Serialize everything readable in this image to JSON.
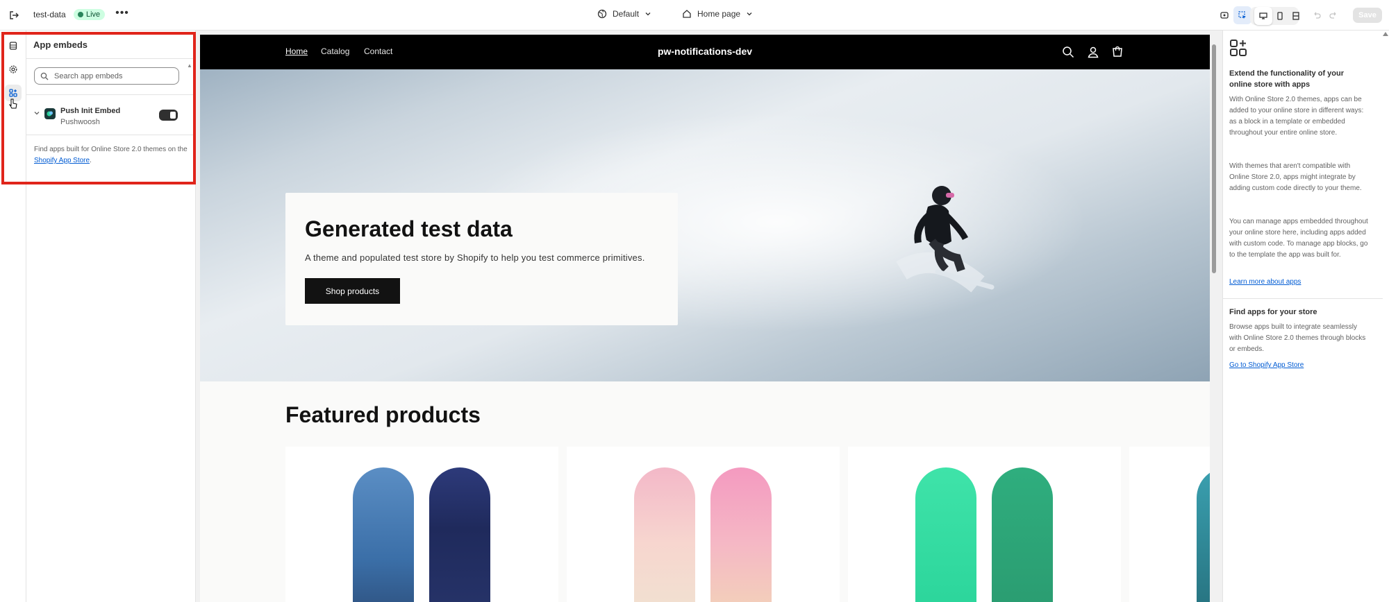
{
  "topbar": {
    "store_name": "test-data",
    "status_badge": "Live",
    "more_label": "•••",
    "theme": "Default",
    "page": "Home page",
    "save_label": "Save"
  },
  "sidebar": {
    "title": "App embeds",
    "search_placeholder": "Search app embeds",
    "embed": {
      "name": "Push Init Embed",
      "provider": "Pushwoosh",
      "enabled": true
    },
    "footer_text": "Find apps built for Online Store 2.0 themes on the ",
    "footer_link": "Shopify App Store",
    "footer_end": "."
  },
  "store": {
    "nav": [
      "Home",
      "Catalog",
      "Contact"
    ],
    "brand": "pw-notifications-dev",
    "hero_title": "Generated test data",
    "hero_subtitle": "A theme and populated test store by Shopify to help you test commerce primitives.",
    "hero_button": "Shop products",
    "featured_title": "Featured products"
  },
  "right_panel": {
    "heading1": "Extend the functionality of your online store with apps",
    "para1": "With Online Store 2.0 themes, apps can be added to your online store in different ways: as a block in a template or embedded throughout your entire online store.",
    "para2": "With themes that aren't compatible with Online Store 2.0, apps might integrate by adding custom code directly to your theme.",
    "para3": "You can manage apps embedded throughout your online store here, including apps added with custom code. To manage app blocks, go to the template the app was built for.",
    "link1": "Learn more about apps",
    "heading2": "Find apps for your store",
    "para4": "Browse apps built to integrate seamlessly with Online Store 2.0 themes through blocks or embeds.",
    "link2": "Go to Shopify App Store"
  },
  "colors": {
    "accent": "#005bd3",
    "highlight": "#e0251b",
    "live_badge": "#cdfee1"
  }
}
